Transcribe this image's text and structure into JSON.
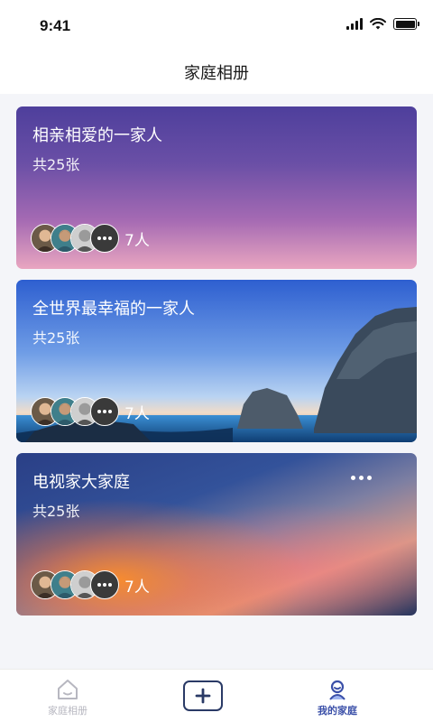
{
  "status_bar": {
    "time": "9:41"
  },
  "nav": {
    "title": "家庭相册"
  },
  "albums": [
    {
      "title": "相亲相爱的一家人",
      "count_text": "共25张",
      "member_count": "7人",
      "background": "purple-gradient"
    },
    {
      "title": "全世界最幸福的一家人",
      "count_text": "共25张",
      "member_count": "7人",
      "background": "ocean-rocks-photo"
    },
    {
      "title": "电视家大家庭",
      "count_text": "共25张",
      "member_count": "7人",
      "background": "sunset-blur-gradient",
      "has_more_menu": true
    }
  ],
  "tab_bar": {
    "items": [
      {
        "label": "家庭相册",
        "icon": "house-icon",
        "active": false
      },
      {
        "label": "我的家庭",
        "icon": "person-icon",
        "active": true
      }
    ],
    "add_icon": "plus-icon"
  },
  "colors": {
    "active_tab": "#3a4fa8",
    "inactive_tab": "#b7b7c0",
    "add_button_border": "#2a3a66",
    "page_background": "#f4f5f9"
  }
}
